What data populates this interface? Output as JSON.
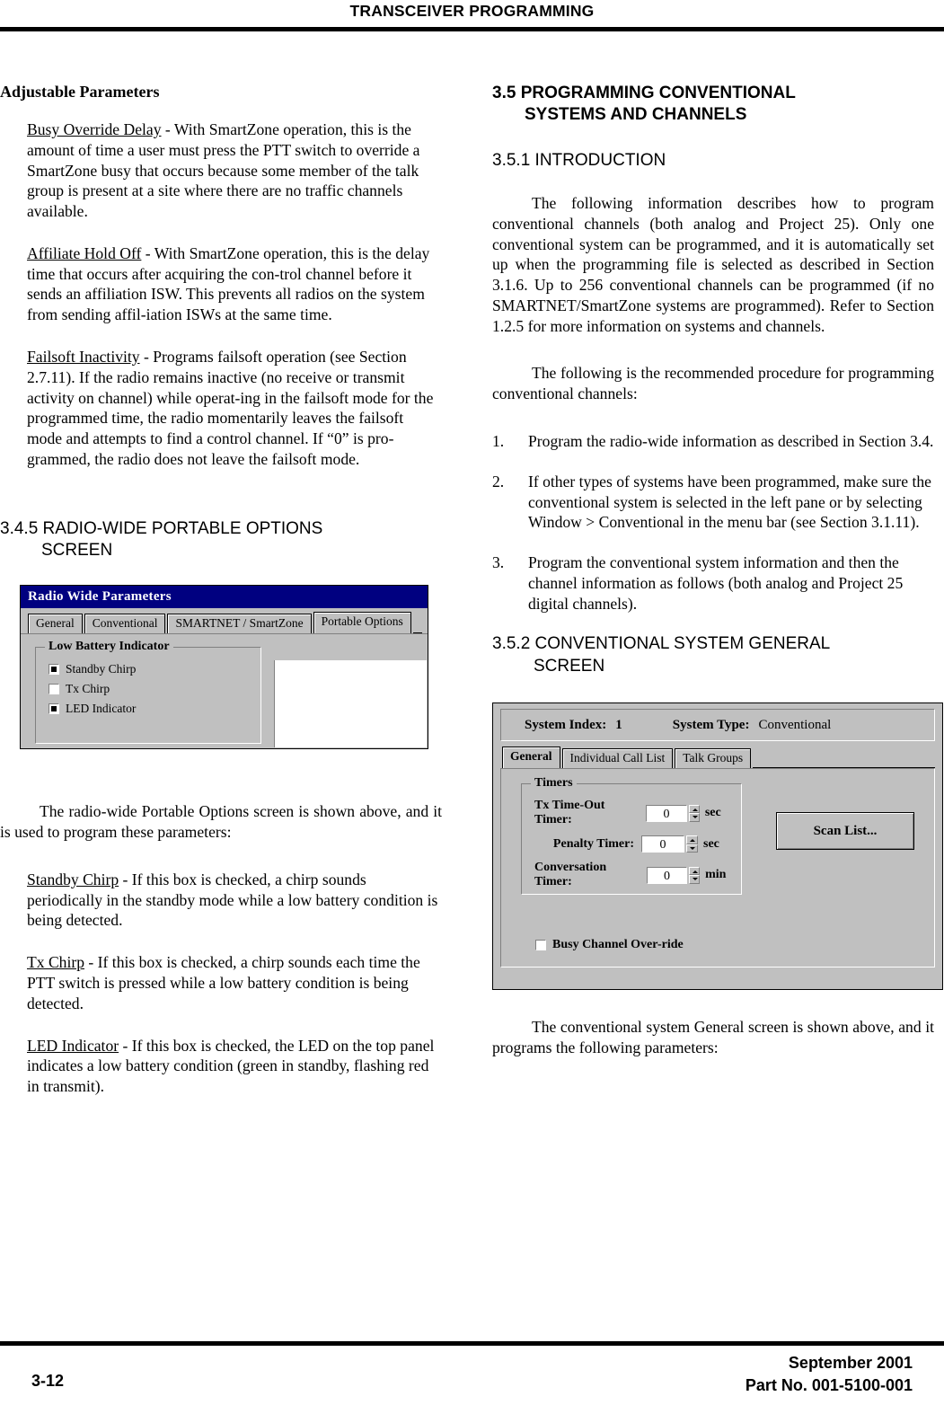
{
  "header": {
    "title": "TRANSCEIVER PROGRAMMING"
  },
  "left_column": {
    "heading": "Adjustable Parameters",
    "params": [
      {
        "term": "Busy Override Delay",
        "text": " - With SmartZone operation, this is the amount of time a user must press the PTT switch to override a SmartZone busy that occurs because some member of the talk group is present at a site where there are no traffic channels available."
      },
      {
        "term": "Affiliate Hold Off",
        "text": " - With SmartZone operation, this is the delay time that occurs after acquiring the con-trol channel before it sends an affiliation ISW. This prevents all radios on the system from sending affil-iation ISWs at the same time."
      },
      {
        "term": "Failsoft Inactivity",
        "text": " - Programs failsoft operation (see Section 2.7.11). If the radio remains inactive (no receive or transmit activity on channel) while operat-ing in the failsoft mode for the programmed time, the radio momentarily leaves the failsoft mode and attempts to find a control channel. If “0” is pro-grammed, the radio does not leave the failsoft mode."
      }
    ],
    "section_number": "3.4.5",
    "section_title_line1": "RADIO-WIDE PORTABLE OPTIONS",
    "section_title_line2": "SCREEN",
    "figure_caption": "The radio-wide Portable Options screen is shown above, and it is used to program these parameters:",
    "params2": [
      {
        "term": "Standby Chirp",
        "text": " - If this box is checked, a chirp sounds periodically in the standby mode while a low battery condition is being detected."
      },
      {
        "term": "Tx Chirp",
        "text": " - If this box is checked, a chirp sounds each time the PTT switch is pressed while a low battery condition is being detected."
      },
      {
        "term": "LED Indicator",
        "text": " - If this box is checked, the LED on the top panel indicates a low battery condition (green in standby, flashing red in transmit)."
      }
    ]
  },
  "figure_radio_wide": {
    "window_title": "Radio Wide Parameters",
    "tabs": [
      "General",
      "Conventional",
      "SMARTNET / SmartZone",
      "Portable Options"
    ],
    "selected_tab": "Portable Options",
    "group_title": "Low Battery Indicator",
    "checkboxes": [
      {
        "label": "Standby Chirp",
        "checked": true
      },
      {
        "label": "Tx Chirp",
        "checked": false
      },
      {
        "label": "LED Indicator",
        "checked": true
      }
    ]
  },
  "right_column": {
    "section_number": "3.5",
    "section_title_line1": "PROGRAMMING CONVENTIONAL",
    "section_title_line2": "SYSTEMS AND CHANNELS",
    "sub1_number": "3.5.1",
    "sub1_title": "INTRODUCTION",
    "intro_para": "The following information describes how to program conventional channels (both analog and Project 25). Only one conventional system can be programmed, and it is automatically set up when the programming file is selected as described in Section 3.1.6. Up to 256 conventional channels can be programmed (if no SMARTNET/SmartZone systems are programmed). Refer to Section 1.2.5 for more information on systems and channels.",
    "procedure_lead": "The following is the recommended procedure for programming conventional channels:",
    "steps": [
      {
        "num": "1.",
        "text": "Program the radio-wide information as described in Section 3.4."
      },
      {
        "num": "2.",
        "text": "If other types of systems have been programmed, make sure the conventional system is selected in the left pane or by selecting Window > Conventional in the menu bar (see Section 3.1.11)."
      },
      {
        "num": "3.",
        "text": "Program the conventional system information and then the channel information as follows (both analog and Project 25 digital channels)."
      }
    ],
    "sub2_number": "3.5.2",
    "sub2_title_line1": "CONVENTIONAL SYSTEM GENERAL",
    "sub2_title_line2": "SCREEN",
    "figure_caption": "The conventional system General screen is shown above, and it programs the following parameters:"
  },
  "figure_conventional": {
    "system_index_label": "System Index:",
    "system_index_value": "1",
    "system_type_label": "System Type:",
    "system_type_value": "Conventional",
    "tabs": [
      "General",
      "Individual Call List",
      "Talk Groups"
    ],
    "selected_tab": "General",
    "group_title": "Timers",
    "timers": [
      {
        "label": "Tx Time-Out Timer:",
        "value": "0",
        "unit": "sec"
      },
      {
        "label": "Penalty Timer:",
        "value": "0",
        "unit": "sec"
      },
      {
        "label": "Conversation Timer:",
        "value": "0",
        "unit": "min"
      }
    ],
    "scan_list_button": "Scan List...",
    "busy_checkbox": {
      "label": "Busy Channel Over-ride",
      "checked": false
    }
  },
  "footer": {
    "page_number": "3-12",
    "date": "September 2001",
    "part_number": "Part No. 001-5100-001"
  }
}
